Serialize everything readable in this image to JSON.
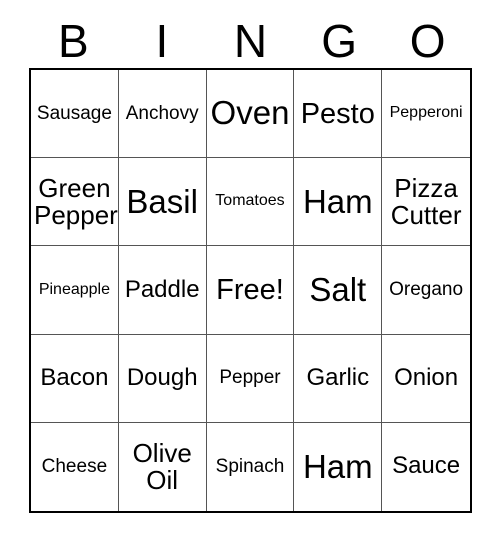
{
  "card": {
    "title": "BINGO",
    "header_letters": [
      "B",
      "I",
      "N",
      "G",
      "O"
    ],
    "columns": 5,
    "rows": 5,
    "free_space_label": "Free!",
    "free_space_position": "center",
    "colors": {
      "background": "#ffffff",
      "text": "#000000",
      "grid_outer_border": "#000000",
      "grid_inner_border": "#555555"
    },
    "cells": [
      [
        {
          "text": "Sausage",
          "size": "sm"
        },
        {
          "text": "Anchovy",
          "size": "sm"
        },
        {
          "text": "Oven",
          "size": "xl"
        },
        {
          "text": "Pesto",
          "size": "lg"
        },
        {
          "text": "Pepperoni",
          "size": "xs"
        }
      ],
      [
        {
          "text": "Green Pepper",
          "size": "two"
        },
        {
          "text": "Basil",
          "size": "xl"
        },
        {
          "text": "Tomatoes",
          "size": "xs"
        },
        {
          "text": "Ham",
          "size": "xl"
        },
        {
          "text": "Pizza Cutter",
          "size": "two"
        }
      ],
      [
        {
          "text": "Pineapple",
          "size": "xs"
        },
        {
          "text": "Paddle",
          "size": "md"
        },
        {
          "text": "Free!",
          "size": "lg"
        },
        {
          "text": "Salt",
          "size": "xl"
        },
        {
          "text": "Oregano",
          "size": "sm"
        }
      ],
      [
        {
          "text": "Bacon",
          "size": "md"
        },
        {
          "text": "Dough",
          "size": "md"
        },
        {
          "text": "Pepper",
          "size": "sm"
        },
        {
          "text": "Garlic",
          "size": "md"
        },
        {
          "text": "Onion",
          "size": "md"
        }
      ],
      [
        {
          "text": "Cheese",
          "size": "sm"
        },
        {
          "text": "Olive Oil",
          "size": "two"
        },
        {
          "text": "Spinach",
          "size": "sm"
        },
        {
          "text": "Ham",
          "size": "xl"
        },
        {
          "text": "Sauce",
          "size": "md"
        }
      ]
    ]
  }
}
